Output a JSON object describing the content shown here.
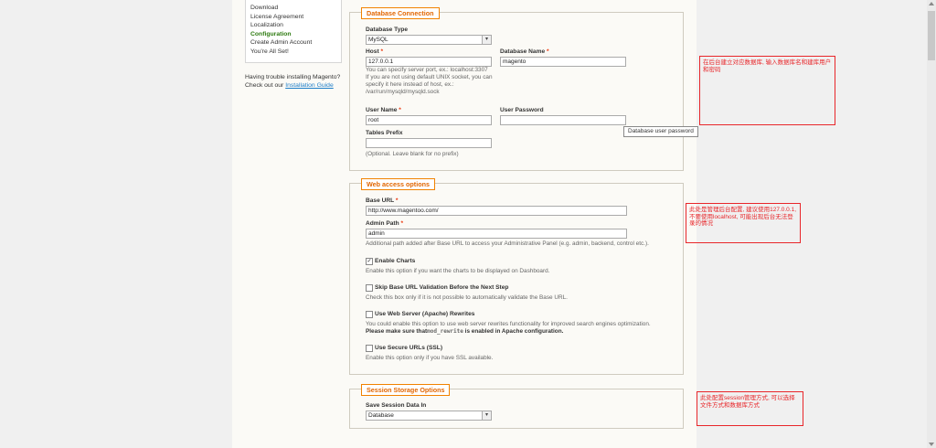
{
  "steps": {
    "items": [
      "Download",
      "License Agreement",
      "Localization",
      "Configuration",
      "Create Admin Account",
      "You're All Set!"
    ],
    "active_index": 3
  },
  "help": {
    "line1": "Having trouble installing Magento?",
    "line2_prefix": "Check out our ",
    "link": "Installation Guide"
  },
  "db": {
    "legend": "Database Connection",
    "type_label": "Database Type",
    "type_value": "MySQL",
    "host_label": "Host",
    "host_value": "127.0.0.1",
    "host_note": "You can specify server port, ex.: localhost:3307\nIf you are not using default UNIX socket, you can specify it here instead of host, ex.: /var/run/mysqld/mysqld.sock",
    "name_label": "Database Name",
    "name_value": "magento",
    "user_label": "User Name",
    "user_value": "root",
    "pass_label": "User Password",
    "pass_value": "",
    "prefix_label": "Tables Prefix",
    "prefix_value": "",
    "prefix_note": "(Optional. Leave blank for no prefix)",
    "tooltip": "Database user password"
  },
  "web": {
    "legend": "Web access options",
    "base_url_label": "Base URL",
    "base_url_value": "http://www.magentoo.com/",
    "admin_path_label": "Admin Path",
    "admin_path_value": "admin",
    "admin_path_note": "Additional path added after Base URL to access your Administrative Panel (e.g. admin, backend, control etc.).",
    "charts_label": "Enable Charts",
    "charts_checked": true,
    "charts_note": "Enable this option if you want the charts to be displayed on Dashboard.",
    "skip_label": "Skip Base URL Validation Before the Next Step",
    "skip_checked": false,
    "skip_note": "Check this box only if it is not possible to automatically validate the Base URL.",
    "rewrites_label": "Use Web Server (Apache) Rewrites",
    "rewrites_checked": false,
    "rewrites_note1": "You could enable this option to use web server rewrites functionality for improved search engines optimization.",
    "rewrites_note2_prefix": "Please make sure that",
    "rewrites_note2_code": "mod_rewrite",
    "rewrites_note2_suffix": " is enabled in Apache configuration.",
    "secure_label": "Use Secure URLs (SSL)",
    "secure_checked": false,
    "secure_note": "Enable this option only if you have SSL available."
  },
  "session": {
    "legend": "Session Storage Options",
    "save_label": "Save Session Data In",
    "save_value": "Database"
  },
  "annotations": {
    "db_note": "在后台建立对应数据库, 输入数据库名和建库用户和密码",
    "web_note": "此处是管理后台配置, 建议使用127.0.0.1, 不要使用localhost, 可能出现后台无法登录的情况",
    "session_note": "此处配置session管理方式, 可以选择文件方式和数据库方式"
  },
  "colors": {
    "legend_border": "#f18200",
    "legend_text": "#e26703",
    "active_step": "#2d7a10",
    "annotation": "#e8262a",
    "link": "#1e7ec8"
  }
}
